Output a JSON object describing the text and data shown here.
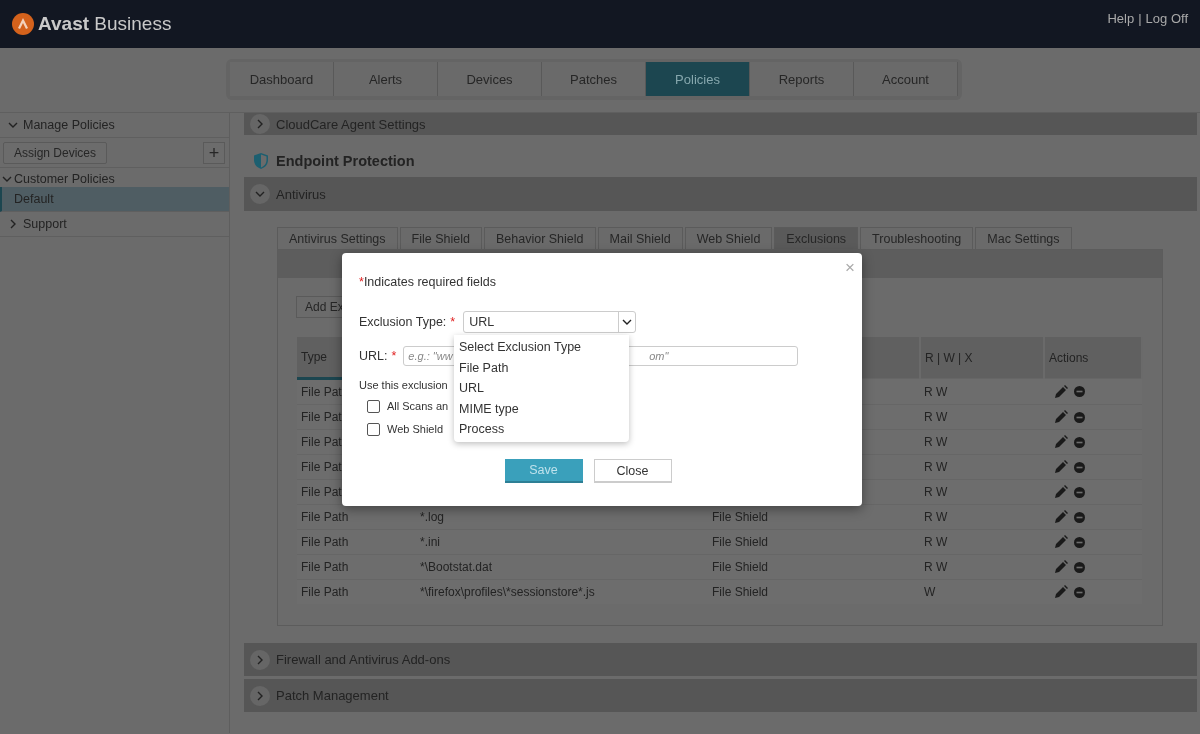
{
  "header": {
    "brand": "**Avast** Business",
    "links": [
      {
        "label": "Help"
      },
      {
        "label": "Log Off"
      }
    ],
    "separator": "|"
  },
  "nav_tabs": [
    {
      "label": "Dashboard",
      "selected": false
    },
    {
      "label": "Alerts",
      "selected": false
    },
    {
      "label": "Devices",
      "selected": false
    },
    {
      "label": "Patches",
      "selected": false
    },
    {
      "label": "Policies",
      "selected": true
    },
    {
      "label": "Reports",
      "selected": false
    },
    {
      "label": "Account",
      "selected": false
    }
  ],
  "sidebar": [
    {
      "kind": "group",
      "label": "Manage Policies",
      "expanded": true
    },
    {
      "kind": "actions",
      "button": "Assign Devices",
      "add": "+"
    },
    {
      "kind": "subgroup",
      "label": "Customer Policies",
      "expanded": true
    },
    {
      "kind": "item",
      "label": "Default",
      "selected": true
    },
    {
      "kind": "group",
      "label": "Support",
      "expanded": false
    }
  ],
  "sections_top": [
    {
      "kind": "accordion",
      "title": "CloudCare Agent Settings",
      "expanded": false
    },
    {
      "kind": "heading",
      "title": "Endpoint Protection"
    },
    {
      "kind": "accordion",
      "title": "Antivirus",
      "expanded": true
    }
  ],
  "antivirus": {
    "tabs": [
      {
        "label": "Antivirus Settings",
        "selected": false
      },
      {
        "label": "File Shield",
        "selected": false
      },
      {
        "label": "Behavior Shield",
        "selected": false
      },
      {
        "label": "Mail Shield",
        "selected": false
      },
      {
        "label": "Web Shield",
        "selected": false
      },
      {
        "label": "Exclusions",
        "selected": true
      },
      {
        "label": "Troubleshooting",
        "selected": false
      },
      {
        "label": "Mac Settings",
        "selected": false
      }
    ],
    "add_button": "Add Ex",
    "columns": {
      "type": "Type",
      "rwx": "R | W | X",
      "actions": "Actions"
    },
    "rows": [
      {
        "type": "File Pat",
        "rwx": "R W"
      },
      {
        "type": "File Pat",
        "rwx": "R W"
      },
      {
        "type": "File Pat",
        "rwx": "R W"
      },
      {
        "type": "File Pat",
        "rwx": "R W"
      },
      {
        "type": "File Pat",
        "rwx": "R W"
      },
      {
        "type": "File Path",
        "path": "*.log",
        "shield": "File Shield",
        "rwx": "R W"
      },
      {
        "type": "File Path",
        "path": "*.ini",
        "shield": "File Shield",
        "rwx": "R W"
      },
      {
        "type": "File Path",
        "path": "*\\Bootstat.dat",
        "shield": "File Shield",
        "rwx": "R W"
      },
      {
        "type": "File Path",
        "path": "*\\firefox\\profiles\\*sessionstore*.js",
        "shield": "File Shield",
        "rwx": "W"
      }
    ]
  },
  "sections_bottom": [
    {
      "kind": "accordion",
      "title": "Firewall and Antivirus Add-ons",
      "expanded": false
    },
    {
      "kind": "accordion",
      "title": "Patch Management",
      "expanded": false
    }
  ],
  "modal": {
    "close": "×",
    "required_mark": "*",
    "required_note": "Indicates required fields",
    "exclusion_type": {
      "label": "Exclusion Type:",
      "value": "URL",
      "options": [
        "Select Exclusion Type",
        "File Path",
        "URL",
        "MIME type",
        "Process"
      ]
    },
    "url": {
      "label": "URL:",
      "placeholder_start": "e.g.: \"ww",
      "placeholder_end": "om\""
    },
    "usage_label": "Use this exclusion",
    "checkboxes": [
      {
        "label": "All Scans an",
        "checked": false
      },
      {
        "label": "Web Shield",
        "checked": false
      }
    ],
    "save": {
      "label": "Save",
      "disabled": true
    },
    "close_button": "Close"
  }
}
